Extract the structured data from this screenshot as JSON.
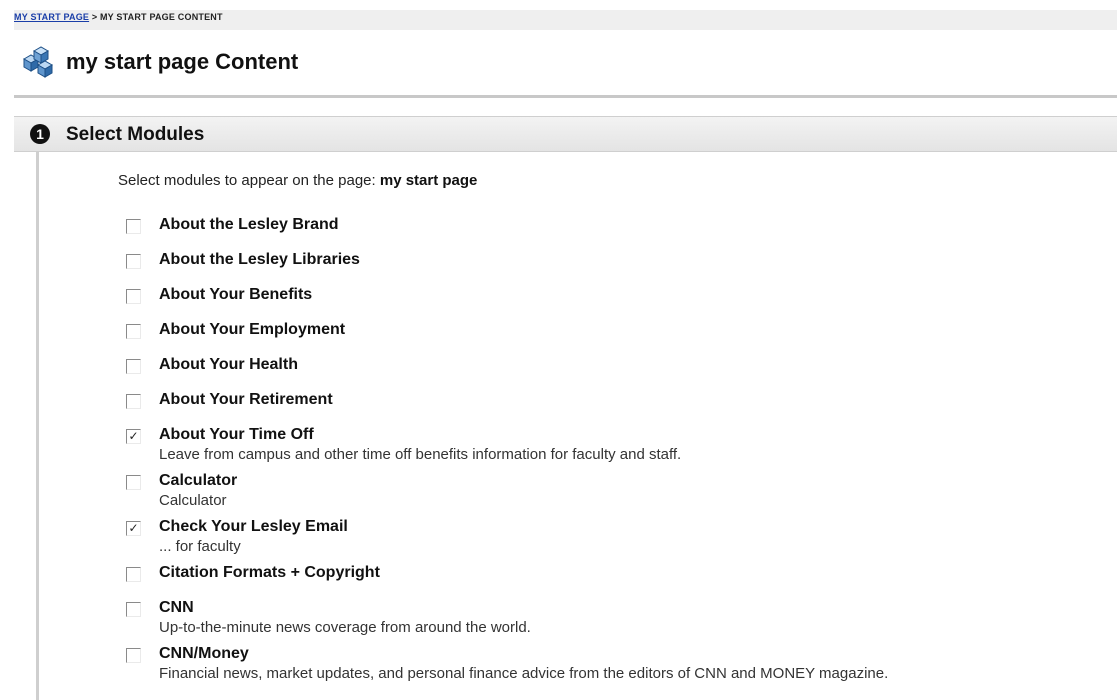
{
  "breadcrumb": {
    "home": "MY START PAGE",
    "separator": ">",
    "current": "MY START PAGE CONTENT"
  },
  "page": {
    "title": "my start page Content",
    "icon": "modules-cubes-icon"
  },
  "section": {
    "step": "1",
    "title": "Select Modules",
    "intro_prefix": "Select modules to appear on the page:",
    "intro_page": "my start page"
  },
  "modules": [
    {
      "name": "About the Lesley Brand",
      "desc": "",
      "checked": false
    },
    {
      "name": "About the Lesley Libraries",
      "desc": "",
      "checked": false
    },
    {
      "name": "About Your Benefits",
      "desc": "",
      "checked": false
    },
    {
      "name": "About Your Employment",
      "desc": "",
      "checked": false
    },
    {
      "name": "About Your Health",
      "desc": "",
      "checked": false
    },
    {
      "name": "About Your Retirement",
      "desc": "",
      "checked": false
    },
    {
      "name": "About Your Time Off",
      "desc": "Leave from campus and other time off benefits information for faculty and staff.",
      "checked": true
    },
    {
      "name": "Calculator",
      "desc": "Calculator",
      "checked": false
    },
    {
      "name": "Check Your Lesley Email",
      "desc": "... for faculty",
      "checked": true
    },
    {
      "name": "Citation Formats + Copyright",
      "desc": "",
      "checked": false
    },
    {
      "name": "CNN",
      "desc": "Up-to-the-minute news coverage from around the world.",
      "checked": false
    },
    {
      "name": "CNN/Money",
      "desc": "Financial news, market updates, and personal finance advice from the editors of CNN and MONEY magazine.",
      "checked": false
    }
  ],
  "checkmark_glyph": "✓"
}
